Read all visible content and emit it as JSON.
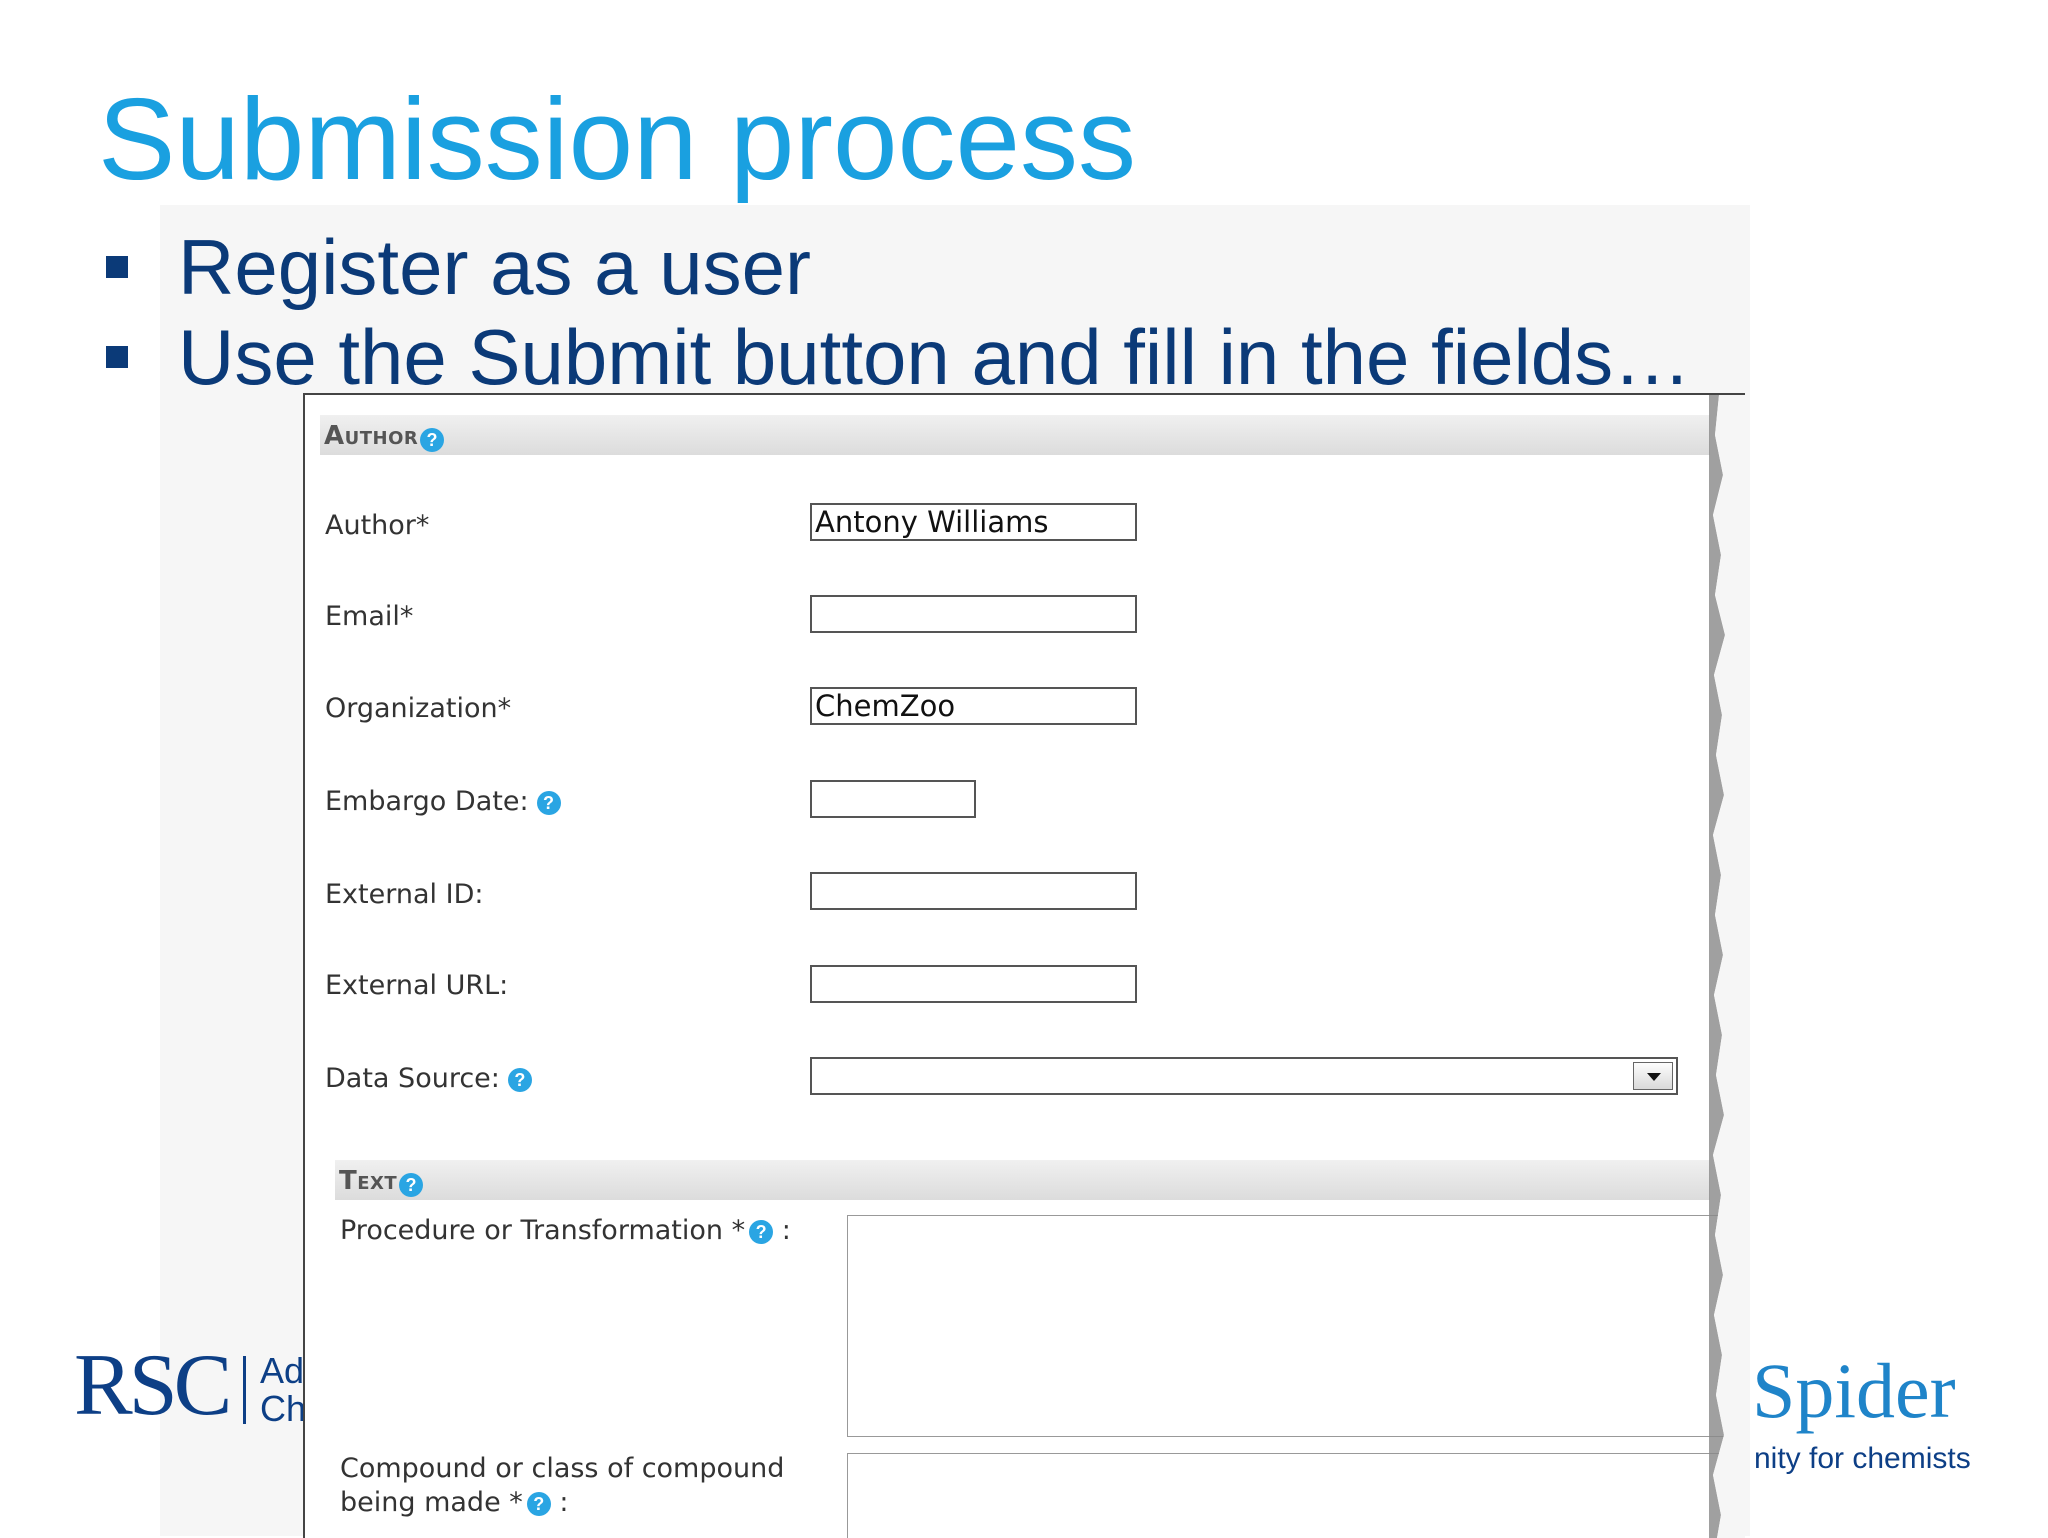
{
  "slide": {
    "title": "Submission process",
    "bullets": [
      "Register as a user",
      "Use the Submit button and fill in the fields…"
    ]
  },
  "logos": {
    "rsc": {
      "text": "RSC",
      "sub_line1": "Ad",
      "sub_line2": "Ch"
    },
    "chemspider": {
      "word": "Spider",
      "tagline": "nity for chemists"
    }
  },
  "form": {
    "author_section": {
      "title": "Author",
      "help_icon": "?"
    },
    "fields": {
      "author": {
        "label": "Author*",
        "value": "Antony Williams"
      },
      "email": {
        "label": "Email*",
        "value": ""
      },
      "organization": {
        "label": "Organization*",
        "value": "ChemZoo"
      },
      "embargo_date": {
        "label": "Embargo Date:",
        "value": ""
      },
      "external_id": {
        "label": "External ID:",
        "value": ""
      },
      "external_url": {
        "label": "External URL:",
        "value": ""
      },
      "data_source": {
        "label": "Data Source:",
        "value": ""
      }
    },
    "text_section": {
      "title": "Text"
    },
    "procedure": {
      "label": "Procedure or Transformation *",
      "suffix": ":"
    },
    "compound": {
      "label_line1": "Compound or class of compound",
      "label_line2": "being made *",
      "suffix": ":"
    }
  },
  "colors": {
    "title": "#1aa0e0",
    "bullet_text": "#0b3a78",
    "help_icon": "#2aa5e3",
    "rsc_blue": "#0d3f86",
    "chemspider_blue": "#1f84c9"
  }
}
